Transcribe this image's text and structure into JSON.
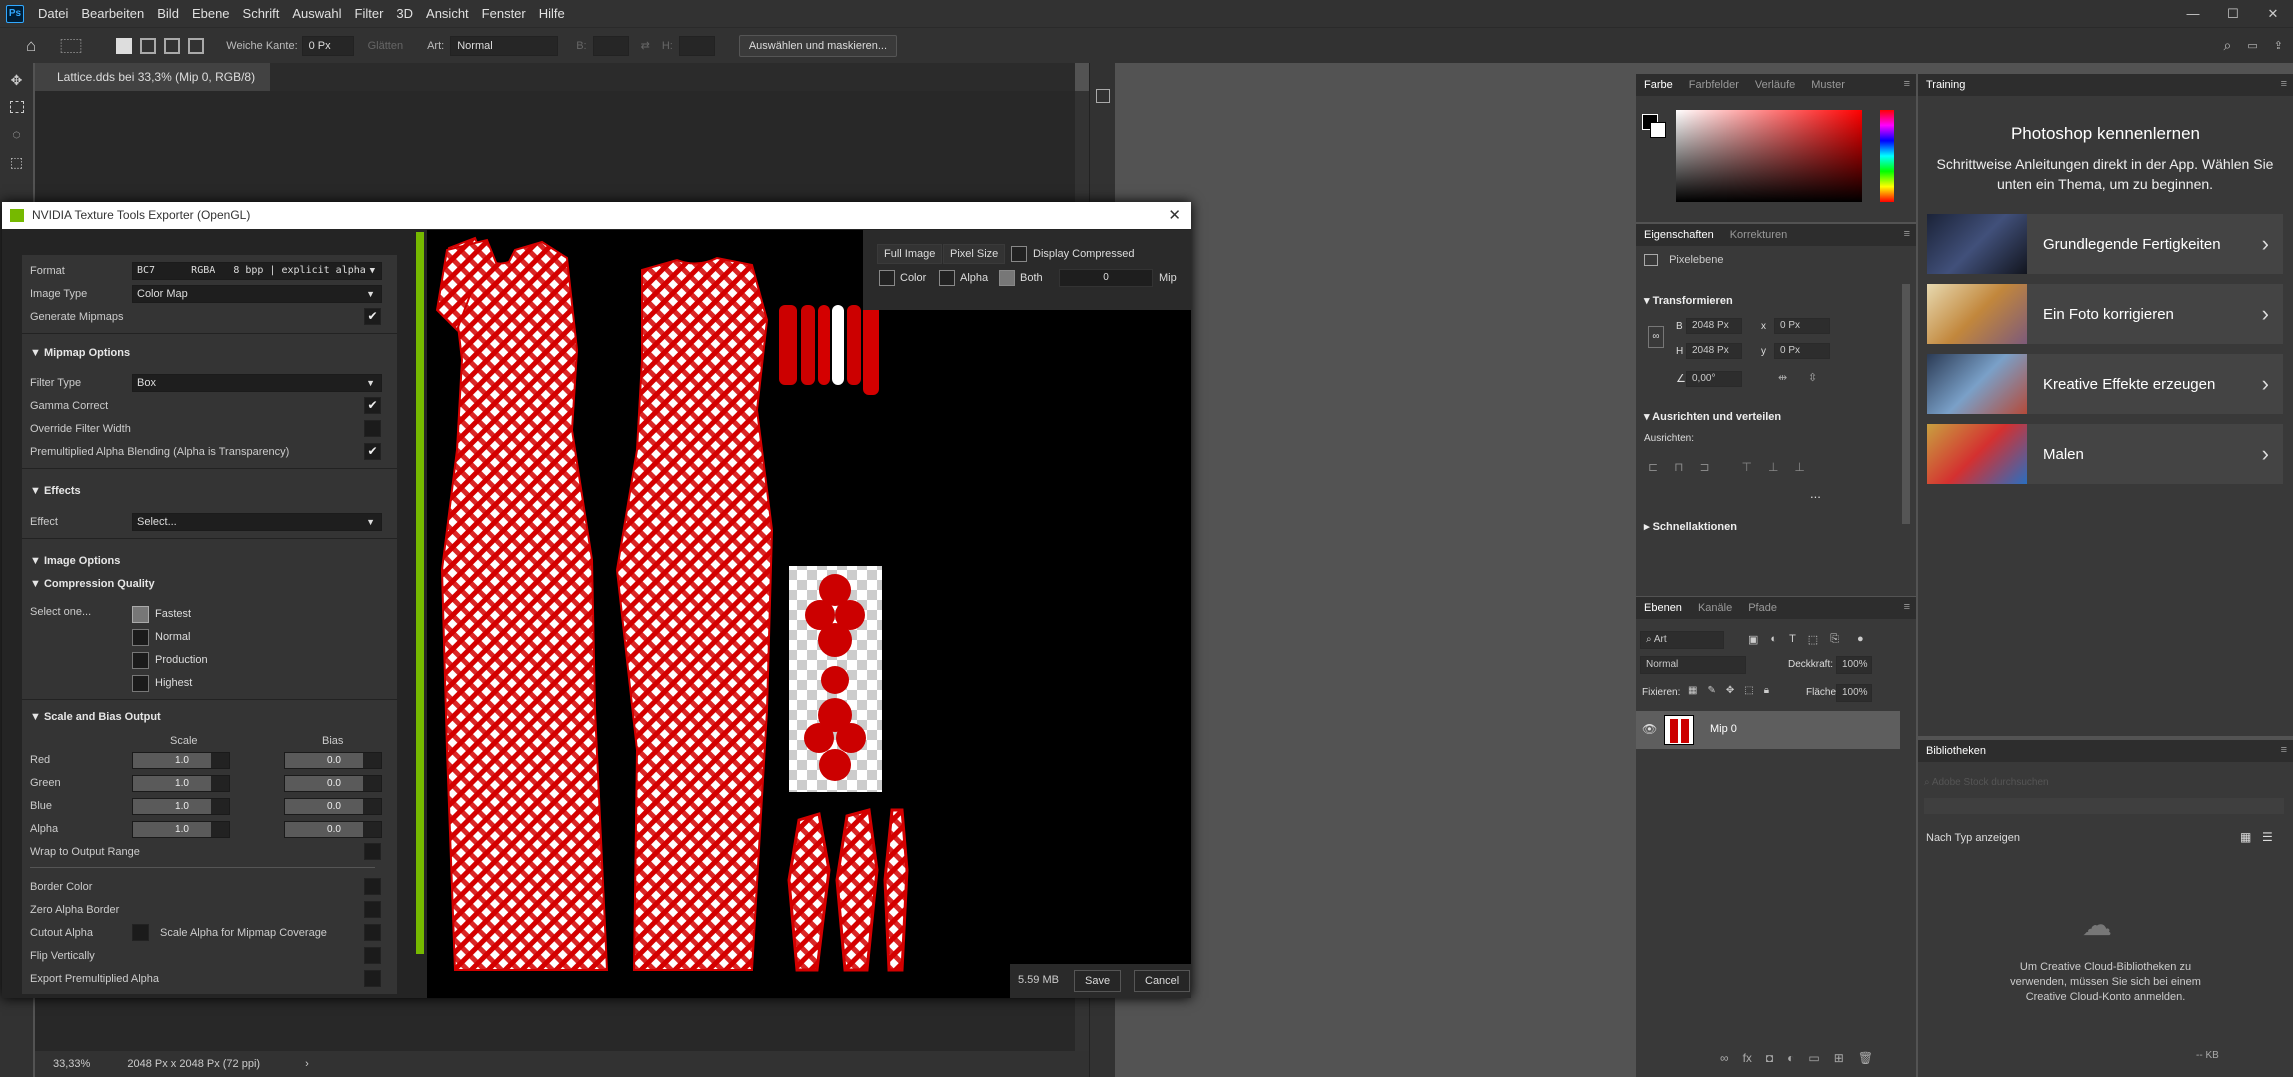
{
  "app": {
    "logo": "Ps",
    "menu": [
      "Datei",
      "Bearbeiten",
      "Bild",
      "Ebene",
      "Schrift",
      "Auswahl",
      "Filter",
      "3D",
      "Ansicht",
      "Fenster",
      "Hilfe"
    ],
    "window_controls": [
      "—",
      "☐",
      "✕"
    ]
  },
  "options_bar": {
    "soft_edge_label": "Weiche Kante:",
    "soft_edge_value": "0 Px",
    "smooth_label": "Glätten",
    "style_label": "Art:",
    "style_value": "Normal",
    "width_label": "B:",
    "height_label": "H:",
    "select_mask_button": "Auswählen und maskieren..."
  },
  "document": {
    "tab_title": "Lattice.dds bei 33,3% (Mip 0, RGB/8)",
    "tab_close": "×"
  },
  "status": {
    "zoom": "33,33%",
    "dims": "2048 Px x 2048 Px (72 ppi)",
    "arrow": "›"
  },
  "color_panel": {
    "tabs": [
      "Farbe",
      "Farbfelder",
      "Verläufe",
      "Muster"
    ]
  },
  "properties_panel": {
    "tabs": [
      "Eigenschaften",
      "Korrekturen"
    ],
    "layer_kind": "Pixelebene",
    "transform_header": "Transformieren",
    "w_label": "B",
    "w_value": "2048 Px",
    "h_label": "H",
    "h_value": "2048 Px",
    "x_label": "x",
    "x_value": "0 Px",
    "y_label": "y",
    "y_value": "0 Px",
    "angle_value": "0,00°",
    "align_header": "Ausrichten und verteilen",
    "align_label": "Ausrichten:",
    "more": "...",
    "quick_actions": "Schnellaktionen"
  },
  "layers_panel": {
    "tabs": [
      "Ebenen",
      "Kanäle",
      "Pfade"
    ],
    "filter_value": "Art",
    "blend_mode": "Normal",
    "opacity_label": "Deckkraft:",
    "opacity_value": "100%",
    "lock_label": "Fixieren:",
    "fill_label": "Fläche:",
    "fill_value": "100%",
    "layer_name": "Mip 0"
  },
  "training_panel": {
    "tab": "Training",
    "title": "Photoshop kennenlernen",
    "subtitle": "Schrittweise Anleitungen direkt in der App. Wählen Sie unten ein Thema, um zu beginnen.",
    "cards": [
      {
        "label": "Grundlegende Fertigkeiten"
      },
      {
        "label": "Ein Foto korrigieren"
      },
      {
        "label": "Kreative Effekte erzeugen"
      },
      {
        "label": "Malen"
      }
    ]
  },
  "libraries_panel": {
    "tab": "Bibliotheken",
    "search_placeholder": "Adobe Stock durchsuchen",
    "view_label": "Nach Typ anzeigen",
    "message": "Um Creative Cloud-Bibliotheken zu verwenden, müssen Sie sich bei einem Creative Cloud-Konto anmelden.",
    "kb_label": "-- KB"
  },
  "dialog": {
    "title": "NVIDIA Texture Tools Exporter (OpenGL)",
    "close": "✕",
    "format_label": "Format",
    "format_value": "BC7      RGBA   8 bpp | explicit alpha",
    "image_type_label": "Image Type",
    "image_type_value": "Color Map",
    "generate_mipmaps": "Generate Mipmaps",
    "mipmap_header": "Mipmap Options",
    "filter_type_label": "Filter Type",
    "filter_type_value": "Box",
    "gamma_correct": "Gamma Correct",
    "override_filter_width": "Override Filter Width",
    "premultiplied_alpha": "Premultiplied Alpha Blending (Alpha is Transparency)",
    "effects_header": "Effects",
    "effect_label": "Effect",
    "effect_value": "Select...",
    "image_options_header": "Image Options",
    "compression_header": "Compression Quality",
    "select_one": "Select one...",
    "quality_options": [
      "Fastest",
      "Normal",
      "Production",
      "Highest"
    ],
    "quality_selected": "Fastest",
    "scale_bias_header": "Scale and Bias Output",
    "scale_col": "Scale",
    "bias_col": "Bias",
    "channels": [
      {
        "name": "Red",
        "scale": "1.0",
        "bias": "0.0"
      },
      {
        "name": "Green",
        "scale": "1.0",
        "bias": "0.0"
      },
      {
        "name": "Blue",
        "scale": "1.0",
        "bias": "0.0"
      },
      {
        "name": "Alpha",
        "scale": "1.0",
        "bias": "0.0"
      }
    ],
    "wrap_output": "Wrap to Output Range",
    "border_color": "Border Color",
    "zero_alpha_border": "Zero Alpha Border",
    "cutout_alpha": "Cutout Alpha",
    "scale_alpha_mip": "Scale Alpha for Mipmap Coverage",
    "flip_vertically": "Flip Vertically",
    "export_premult": "Export Premultiplied Alpha",
    "preview": {
      "full_image": "Full Image",
      "pixel_size": "Pixel Size",
      "display_compressed": "Display Compressed",
      "color": "Color",
      "alpha": "Alpha",
      "both": "Both",
      "mip_value": "0",
      "mip_label": "Mip"
    },
    "file_size": "5.59 MB",
    "save": "Save",
    "cancel": "Cancel"
  },
  "colors": {
    "accent_green": "#76b900",
    "pattern_red": "#d40000",
    "ui_dark": "#323232"
  }
}
